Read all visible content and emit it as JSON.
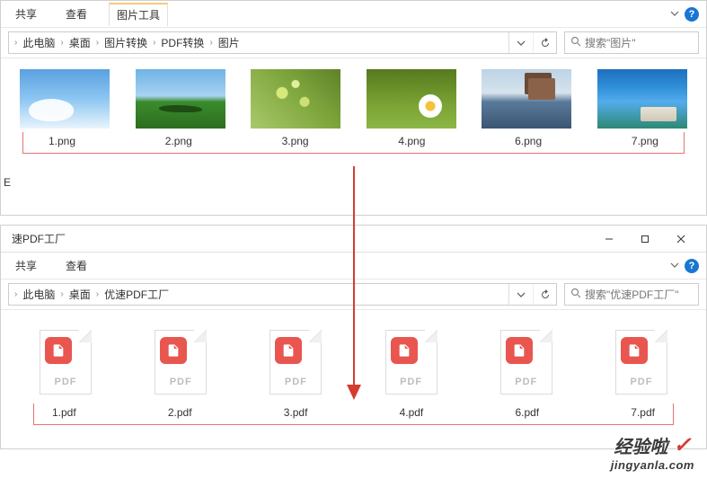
{
  "topWindow": {
    "ribbon": {
      "tabs": [
        "共享",
        "查看"
      ],
      "activeTab": "图片工具"
    },
    "breadcrumb": [
      "此电脑",
      "桌面",
      "图片转换",
      "PDF转换",
      "图片"
    ],
    "search": {
      "placeholder": "搜索\"图片\""
    },
    "files": [
      {
        "name": "1.png",
        "thumb": "sky1"
      },
      {
        "name": "2.png",
        "thumb": "field2"
      },
      {
        "name": "3.png",
        "thumb": "leaves3"
      },
      {
        "name": "4.png",
        "thumb": "flower4"
      },
      {
        "name": "6.png",
        "thumb": "lake6"
      },
      {
        "name": "7.png",
        "thumb": "coast7"
      }
    ]
  },
  "bottomWindow": {
    "title": "速PDF工厂",
    "ribbon": {
      "tabs": [
        "共享",
        "查看"
      ]
    },
    "breadcrumb": [
      "此电脑",
      "桌面",
      "优速PDF工厂"
    ],
    "search": {
      "placeholder": "搜索\"优速PDF工厂\""
    },
    "files": [
      {
        "name": "1.pdf"
      },
      {
        "name": "2.pdf"
      },
      {
        "name": "3.pdf"
      },
      {
        "name": "4.pdf"
      },
      {
        "name": "6.pdf"
      },
      {
        "name": "7.pdf"
      }
    ],
    "pdfBadgeText": "PDF"
  },
  "helpGlyph": "?",
  "watermark": {
    "line1": "经验啦",
    "line2": "jingyanla.com"
  },
  "sidebarLetter": "E"
}
